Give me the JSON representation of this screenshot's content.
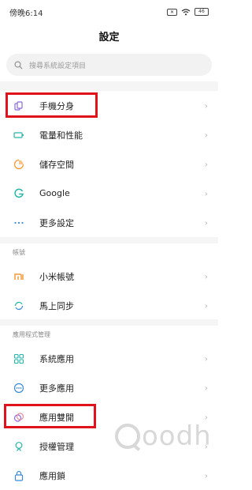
{
  "status_bar": {
    "time": "傍晚6:14",
    "battery": "46"
  },
  "page_title": "設定",
  "search": {
    "placeholder": "搜尋系統設定項目"
  },
  "groups": [
    {
      "items": [
        {
          "label": "手機分身",
          "icon": "dual-apps-icon"
        },
        {
          "label": "電量和性能",
          "icon": "battery-icon"
        },
        {
          "label": "儲存空間",
          "icon": "storage-icon"
        },
        {
          "label": "Google",
          "icon": "google-icon"
        },
        {
          "label": "更多設定",
          "icon": "more-dots-icon"
        }
      ]
    },
    {
      "header": "帳號",
      "items": [
        {
          "label": "小米帳號",
          "icon": "mi-logo-icon"
        },
        {
          "label": "馬上同步",
          "icon": "sync-icon"
        }
      ]
    },
    {
      "header": "應用程式管理",
      "items": [
        {
          "label": "系統應用",
          "icon": "system-apps-icon"
        },
        {
          "label": "更多應用",
          "icon": "more-apps-icon"
        },
        {
          "label": "應用雙開",
          "icon": "dual-open-icon"
        },
        {
          "label": "授權管理",
          "icon": "permissions-icon"
        },
        {
          "label": "應用鎖",
          "icon": "app-lock-icon"
        }
      ]
    }
  ],
  "watermark": "oodh",
  "colors": {
    "highlight": "#e0121b",
    "accent_orange": "#f39a3a",
    "accent_teal": "#27b5a6",
    "accent_purple": "#8a6bd6"
  }
}
